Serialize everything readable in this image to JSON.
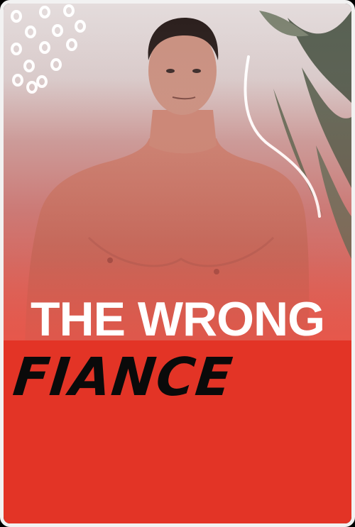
{
  "poster": {
    "title_line1": "THE WRONG",
    "title_line2": "FIANCE"
  },
  "colors": {
    "panel_red": "#e33426",
    "border": "#f2f2f2",
    "title_white": "#ffffff",
    "title_black": "#0a0a0a"
  }
}
